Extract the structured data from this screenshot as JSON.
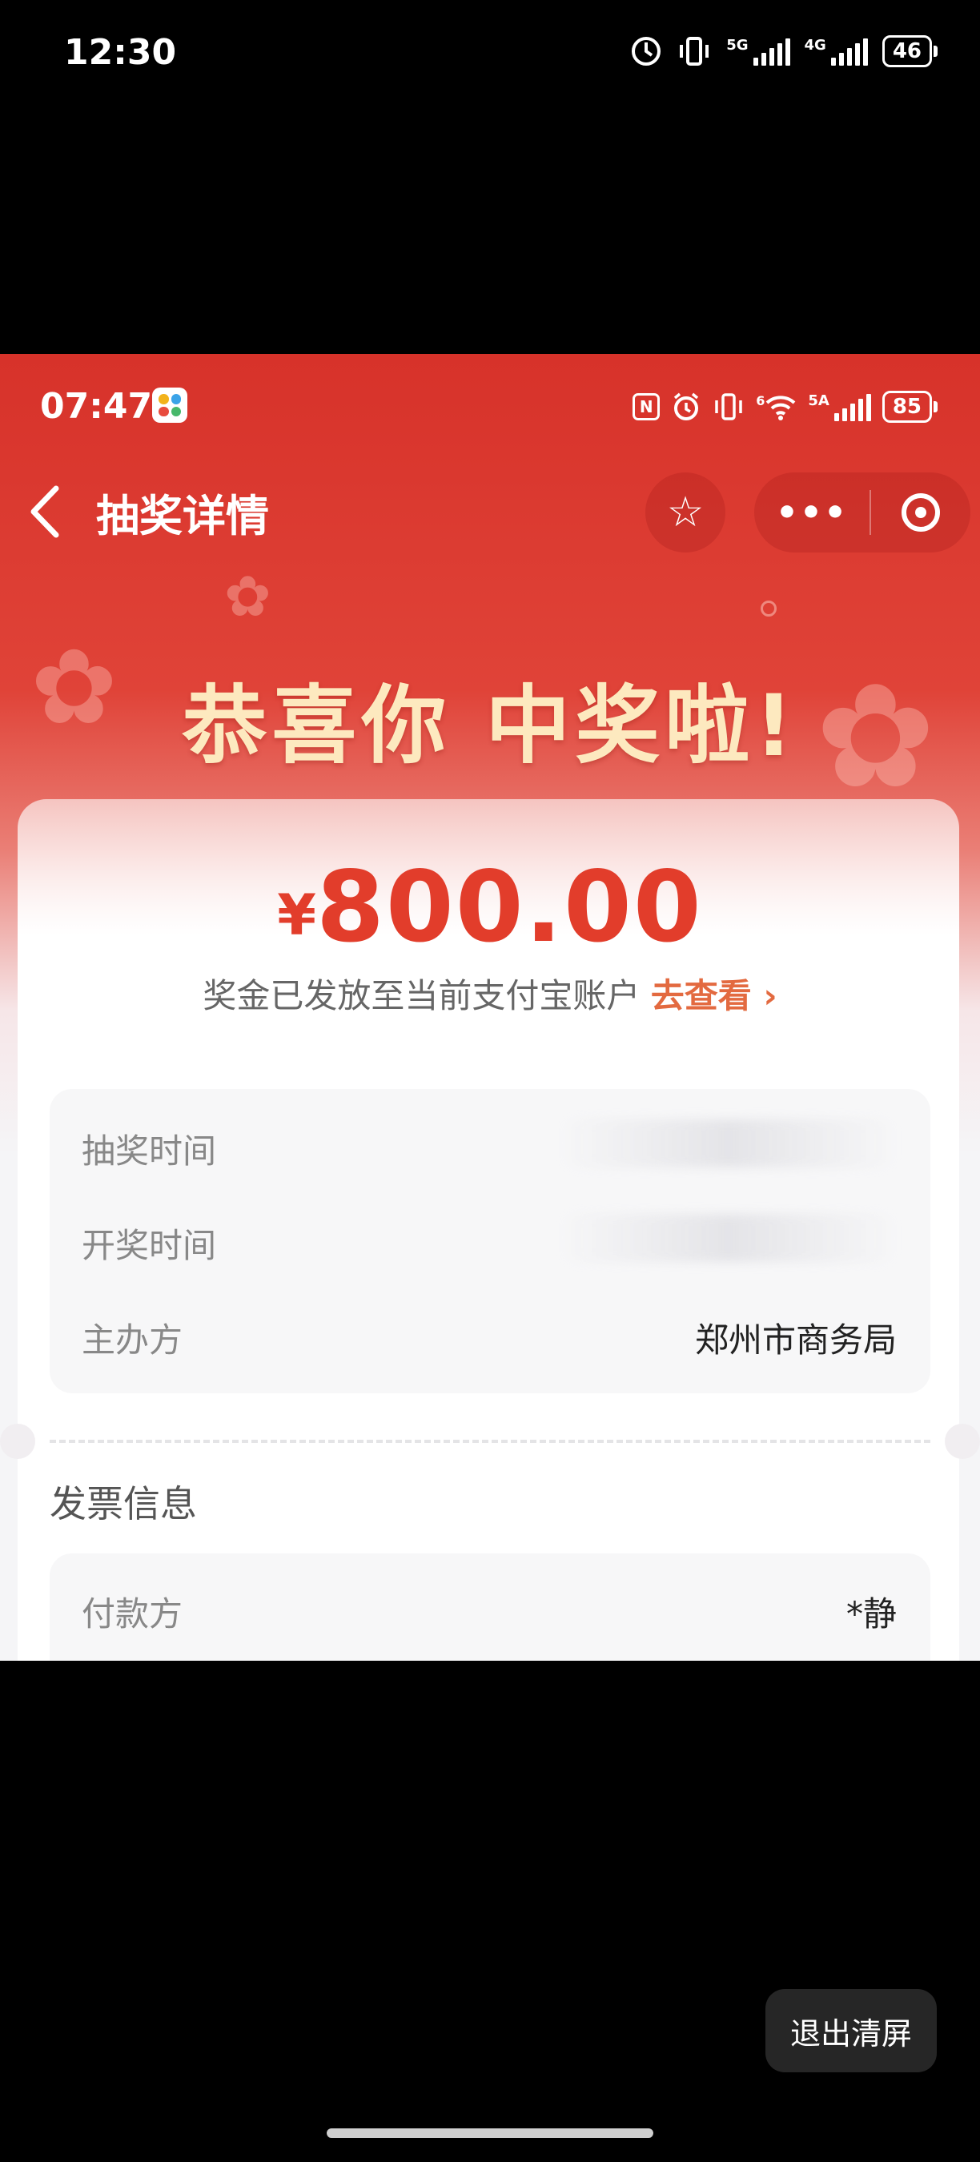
{
  "device_status": {
    "time": "12:30",
    "network_5g": "5G",
    "network_4g": "4G",
    "battery": "46"
  },
  "inner_status": {
    "time": "07:47",
    "nfc": "N",
    "network_6": "6",
    "network_5a": "5A",
    "battery": "85"
  },
  "nav": {
    "back_icon": "<",
    "title": "抽奖详情",
    "favorite_icon": "☆",
    "more_icon": "•••"
  },
  "headline": "恭喜你 中奖啦!",
  "prize": {
    "currency": "¥",
    "amount": "800.00",
    "notice": "奖金已发放至当前支付宝账户",
    "link_label": "去查看",
    "link_arrow": "›"
  },
  "lottery_info": [
    {
      "label": "抽奖时间",
      "value": ""
    },
    {
      "label": "开奖时间",
      "value": ""
    },
    {
      "label": "主办方",
      "value": "郑州市商务局"
    }
  ],
  "invoice": {
    "section_title": "发票信息",
    "rows": [
      {
        "label": "付款方",
        "value": "*静"
      }
    ]
  },
  "exit_button": "退出清屏",
  "colors": {
    "header_red": "#d7322a",
    "amount_red": "#e23d2b",
    "link_orange": "#e36a40",
    "headline_cream": "#fde9bf"
  },
  "icons": [
    "chevron-left-icon",
    "star-icon",
    "more-icon",
    "close-mini-program-icon",
    "flower-decoration-icon"
  ]
}
